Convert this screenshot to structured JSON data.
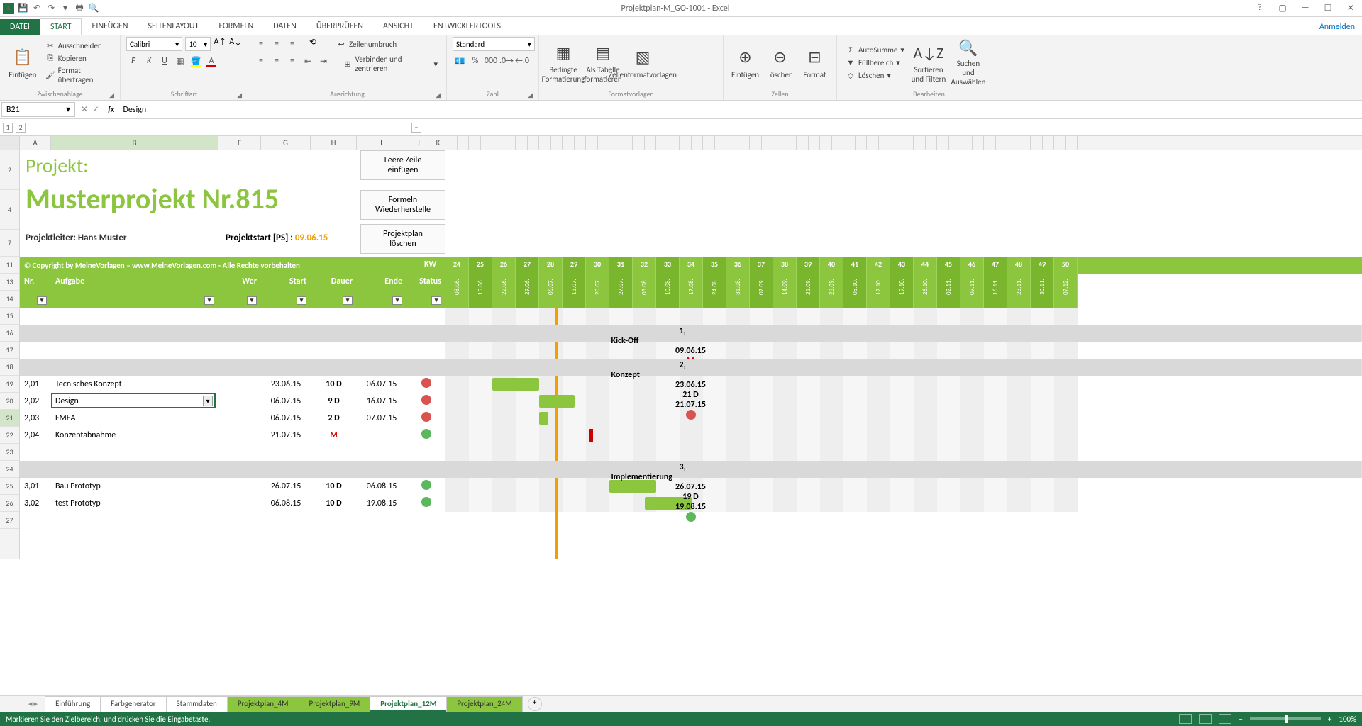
{
  "titlebar": {
    "title": "Projektplan-M_GO-1001 - Excel"
  },
  "tabs": {
    "file": "DATEI",
    "items": [
      "START",
      "EINFÜGEN",
      "SEITENLAYOUT",
      "FORMELN",
      "DATEN",
      "ÜBERPRÜFEN",
      "ANSICHT",
      "ENTWICKLERTOOLS"
    ],
    "active": 0,
    "signin": "Anmelden"
  },
  "ribbon": {
    "clipboard": {
      "paste": "Einfügen",
      "cut": "Ausschneiden",
      "copy": "Kopieren",
      "format": "Format übertragen",
      "label": "Zwischenablage"
    },
    "font": {
      "name": "Calibri",
      "size": "10",
      "label": "Schriftart"
    },
    "align": {
      "wrap": "Zeilenumbruch",
      "merge": "Verbinden und zentrieren",
      "label": "Ausrichtung"
    },
    "number": {
      "format": "Standard",
      "label": "Zahl"
    },
    "styles": {
      "cond": "Bedingte Formatierung",
      "table": "Als Tabelle formatieren",
      "cell": "Zellenformatvorlagen",
      "label": "Formatvorlagen"
    },
    "cells": {
      "insert": "Einfügen",
      "delete": "Löschen",
      "format": "Format",
      "label": "Zellen"
    },
    "editing": {
      "sum": "AutoSumme",
      "fill": "Füllbereich",
      "clear": "Löschen",
      "sort": "Sortieren und Filtern",
      "find": "Suchen und Auswählen",
      "label": "Bearbeiten"
    }
  },
  "formulaBar": {
    "name": "B21",
    "value": "Design"
  },
  "columns": [
    "A",
    "B",
    "F",
    "G",
    "H",
    "I",
    "J",
    "K"
  ],
  "rowHeaders": [
    "2",
    "4",
    "7",
    "11",
    "13",
    "14",
    "15",
    "16",
    "17",
    "18",
    "19",
    "20",
    "21",
    "22",
    "23",
    "24",
    "25",
    "26",
    "27"
  ],
  "project": {
    "label": "Projekt:",
    "name": "Musterprojekt Nr.815",
    "leader": "Projektleiter: Hans Muster",
    "startLabel": "Projektstart [PS] :",
    "startDate": "09.06.15",
    "copyright": "© Copyright by MeineVorlagen – www.MeineVorlagen.com - Alle Rechte vorbehalten",
    "btn1": "Leere Zeile einfügen",
    "btn2": "Formeln Wiederherstelle",
    "btn3": "Projektplan löschen"
  },
  "headers": {
    "nr": "Nr.",
    "task": "Aufgabe",
    "who": "Wer",
    "start": "Start",
    "dur": "Dauer",
    "end": "Ende",
    "status": "Status",
    "kw": "KW"
  },
  "weeks": [
    {
      "n": "24",
      "d": "08.06."
    },
    {
      "n": "25",
      "d": "15.06."
    },
    {
      "n": "26",
      "d": "22.06."
    },
    {
      "n": "27",
      "d": "29.06."
    },
    {
      "n": "28",
      "d": "06.07."
    },
    {
      "n": "29",
      "d": "13.07."
    },
    {
      "n": "30",
      "d": "20.07."
    },
    {
      "n": "31",
      "d": "27.07."
    },
    {
      "n": "32",
      "d": "03.08."
    },
    {
      "n": "33",
      "d": "10.08."
    },
    {
      "n": "34",
      "d": "17.08."
    },
    {
      "n": "35",
      "d": "24.08."
    },
    {
      "n": "36",
      "d": "31.08."
    },
    {
      "n": "37",
      "d": "07.09."
    },
    {
      "n": "38",
      "d": "14.09."
    },
    {
      "n": "39",
      "d": "21.09."
    },
    {
      "n": "40",
      "d": "28.09."
    },
    {
      "n": "41",
      "d": "05.10."
    },
    {
      "n": "42",
      "d": "12.10."
    },
    {
      "n": "43",
      "d": "19.10."
    },
    {
      "n": "44",
      "d": "26.10."
    },
    {
      "n": "45",
      "d": "02.11."
    },
    {
      "n": "46",
      "d": "09.11."
    },
    {
      "n": "47",
      "d": "16.11."
    },
    {
      "n": "48",
      "d": "23.11."
    },
    {
      "n": "49",
      "d": "30.11."
    },
    {
      "n": "50",
      "d": "07.12."
    }
  ],
  "rows": [
    {
      "nr": "1,",
      "task": "Kick-Off",
      "start": "09.06.15",
      "dur": "M",
      "end": "",
      "status": "red",
      "group": true,
      "ms": 0
    },
    {
      "blank": true
    },
    {
      "nr": "2,",
      "task": "Konzept",
      "start": "23.06.15",
      "dur": "21 D",
      "end": "21.07.15",
      "status": "red",
      "group": true,
      "barStart": 2,
      "barLen": 4,
      "barType": "dark"
    },
    {
      "nr": "2,01",
      "task": "Tecnisches Konzept",
      "start": "23.06.15",
      "dur": "10 D",
      "end": "06.07.15",
      "status": "red",
      "barStart": 2,
      "barLen": 2,
      "barType": "light"
    },
    {
      "nr": "2,02",
      "task": "Design",
      "start": "06.07.15",
      "dur": "9 D",
      "end": "16.07.15",
      "status": "red",
      "sel": true,
      "barStart": 4,
      "barLen": 1.5,
      "barType": "light"
    },
    {
      "nr": "2,03",
      "task": "FMEA",
      "start": "06.07.15",
      "dur": "2 D",
      "end": "07.07.15",
      "status": "red",
      "barStart": 4,
      "barLen": 0.4,
      "barType": "light"
    },
    {
      "nr": "2,04",
      "task": "Konzeptabnahme",
      "start": "21.07.15",
      "dur": "M",
      "end": "",
      "status": "green",
      "ms": 6
    },
    {
      "blank": true
    },
    {
      "nr": "3,",
      "task": "Implementierung",
      "start": "26.07.15",
      "dur": "19 D",
      "end": "19.08.15",
      "status": "green",
      "group": true,
      "barStart": 7,
      "barLen": 3.5,
      "barType": "dark"
    },
    {
      "nr": "3,01",
      "task": "Bau Prototyp",
      "start": "26.07.15",
      "dur": "10 D",
      "end": "06.08.15",
      "status": "green",
      "barStart": 7,
      "barLen": 2,
      "barType": "light"
    },
    {
      "nr": "3,02",
      "task": "test Prototyp",
      "start": "06.08.15",
      "dur": "10 D",
      "end": "19.08.15",
      "status": "green",
      "barStart": 8.5,
      "barLen": 2,
      "barType": "light"
    }
  ],
  "sheetTabs": {
    "items": [
      "Einführung",
      "Farbgenerator",
      "Stammdaten",
      "Projektplan_4M",
      "Projektplan_9M",
      "Projektplan_12M",
      "Projektplan_24M"
    ],
    "greenStart": 3,
    "active": 5
  },
  "statusbar": {
    "msg": "Markieren Sie den Zielbereich, und drücken Sie die Eingabetaste.",
    "zoom": "100%"
  }
}
